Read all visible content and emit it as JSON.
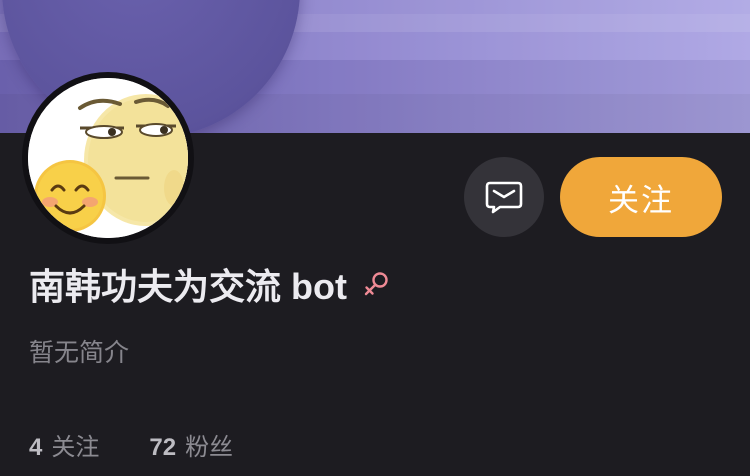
{
  "profile": {
    "name": "南韩功夫为交流 bot",
    "gender_icon": "female-icon",
    "bio": "暂无简介",
    "avatar_icon": "emoji-sticker-avatar"
  },
  "actions": {
    "message_icon": "message-icon",
    "follow_label": "关注"
  },
  "stats": {
    "following": {
      "count": "4",
      "label": "关注"
    },
    "followers": {
      "count": "72",
      "label": "粉丝"
    }
  },
  "colors": {
    "background": "#1d1c21",
    "follow_button": "#f0a73a",
    "message_button": "#343339",
    "cover_gradient_start": "#6f64b3",
    "cover_gradient_end": "#aaa3e3",
    "gender_icon": "#ef8a95"
  }
}
